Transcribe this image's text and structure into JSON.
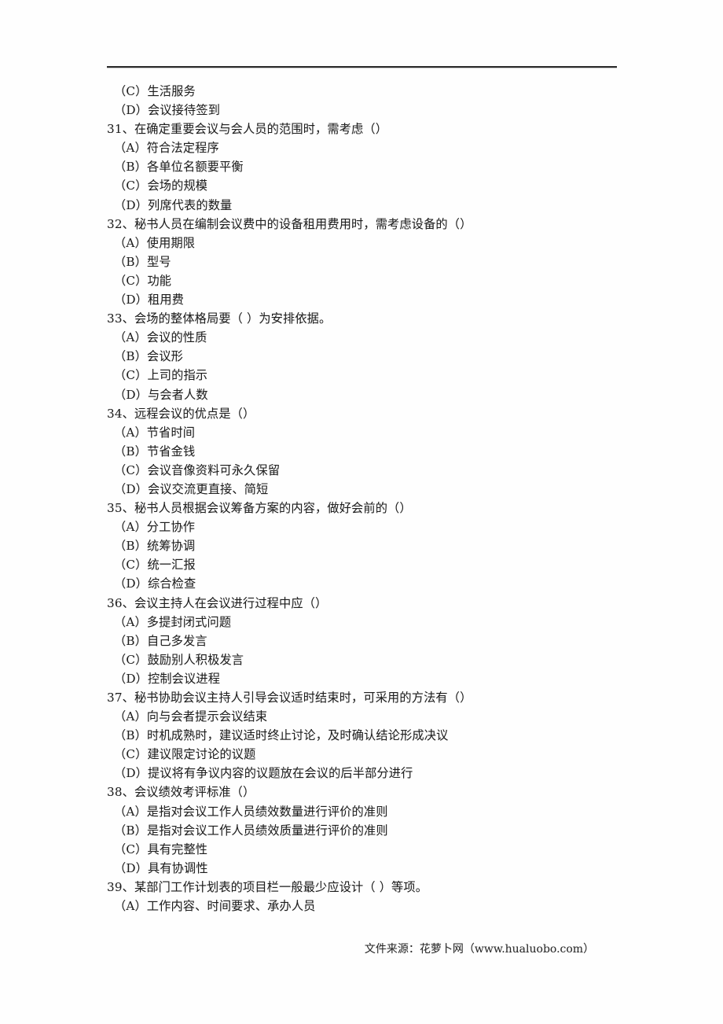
{
  "document": {
    "type": "exam-multiple-choice-page",
    "language": "zh-CN",
    "has_top_rule": true,
    "text_color": "#1f1f1f",
    "background_color": "#ffffff"
  },
  "orphan_options_top": [
    {
      "label": "（C）生活服务"
    },
    {
      "label": "（D）会议接待签到"
    }
  ],
  "questions": [
    {
      "number": "31",
      "stem": "31、在确定重要会议与会人员的范围时，需考虑（）",
      "options": [
        "（A）符合法定程序",
        "（B）各单位名额要平衡",
        "（C）会场的规模",
        "（D）列席代表的数量"
      ]
    },
    {
      "number": "32",
      "stem": "32、秘书人员在编制会议费中的设备租用费用时，需考虑设备的（）",
      "options": [
        "（A）使用期限",
        "（B）型号",
        "（C）功能",
        "（D）租用费"
      ]
    },
    {
      "number": "33",
      "stem": "33、会场的整体格局要（ ）为安排依据。",
      "options": [
        "（A）会议的性质",
        "（B）会议形",
        "（C）上司的指示",
        "（D）与会者人数"
      ]
    },
    {
      "number": "34",
      "stem": "34、远程会议的优点是（）",
      "options": [
        "（A）节省时间",
        "（B）节省金钱",
        "（C）会议音像资料可永久保留",
        "（D）会议交流更直接、简短"
      ]
    },
    {
      "number": "35",
      "stem": "35、秘书人员根据会议筹备方案的内容，做好会前的（）",
      "options": [
        "（A）分工协作",
        "（B）统筹协调",
        "（C）统一汇报",
        "（D）综合检查"
      ]
    },
    {
      "number": "36",
      "stem": "36、会议主持人在会议进行过程中应（）",
      "options": [
        "（A）多提封闭式问题",
        "（B）自己多发言",
        "（C）鼓励别人积极发言",
        "（D）控制会议进程"
      ]
    },
    {
      "number": "37",
      "stem": "37、秘书协助会议主持人引导会议适时结束时，可采用的方法有（）",
      "options": [
        "（A）向与会者提示会议结束",
        "（B）时机成熟时，建议适时终止讨论，及时确认结论形成决议",
        "（C）建议限定讨论的议题",
        "（D）提议将有争议内容的议题放在会议的后半部分进行"
      ]
    },
    {
      "number": "38",
      "stem": "38、会议绩效考评标准（）",
      "options": [
        "（A）是指对会议工作人员绩效数量进行评价的准则",
        "（B）是指对会议工作人员绩效质量进行评价的准则",
        "（C）具有完整性",
        "（D）具有协调性"
      ]
    },
    {
      "number": "39",
      "stem": "39、某部门工作计划表的项目栏一般最少应设计（ ）等项。",
      "options": [
        "（A）工作内容、时间要求、承办人员"
      ]
    }
  ],
  "footer": {
    "source_text": "文件来源：花萝卜网（www.hualuobo.com）"
  }
}
